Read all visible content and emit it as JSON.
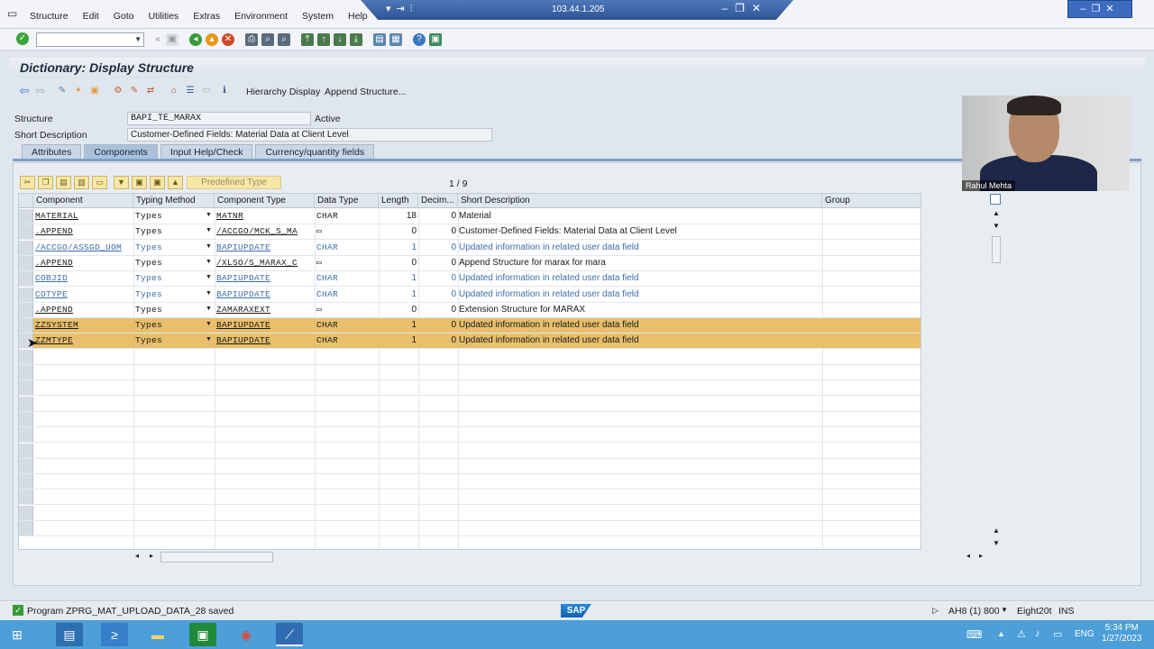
{
  "menubar": {
    "items": [
      "Structure",
      "Edit",
      "Goto",
      "Utilities",
      "Extras",
      "Environment",
      "System",
      "Help"
    ]
  },
  "remote": {
    "ip": "103.44.1.205"
  },
  "toolbar": {
    "command_value": ""
  },
  "title": "Dictionary: Display Structure",
  "app_toolbar": {
    "hierarchy": "Hierarchy Display",
    "append": "Append Structure..."
  },
  "header": {
    "structure_label": "Structure",
    "structure_value": "BAPI_TE_MARAX",
    "status": "Active",
    "short_desc_label": "Short Description",
    "short_desc_value": "Customer-Defined Fields: Material Data at Client Level"
  },
  "tabs": [
    "Attributes",
    "Components",
    "Input Help/Check",
    "Currency/quantity fields"
  ],
  "active_tab": "Components",
  "table_controls": {
    "predefined_type": "Predefined Type",
    "pager": "1 / 9"
  },
  "columns": [
    "Component",
    "Typing Method",
    "Component Type",
    "Data Type",
    "Length",
    "Decim...",
    "Short Description",
    "Group"
  ],
  "rows": [
    {
      "component": "MATERIAL",
      "typing": "Types",
      "comptype": "MATNR",
      "datatype": "CHAR",
      "length": "18",
      "decimals": "0",
      "desc": "Material"
    },
    {
      "component": ".APPEND",
      "typing": "Types",
      "comptype": "/ACCGO/MCK_S_MA",
      "datatype": "▭",
      "length": "0",
      "decimals": "0",
      "desc": "Customer-Defined Fields: Material Data at Client Level"
    },
    {
      "component": "/ACCGO/ASSGD_UOM",
      "typing": "Types",
      "comptype": "BAPIUPDATE",
      "datatype": "CHAR",
      "length": "1",
      "decimals": "0",
      "desc": "Updated information in related user data field"
    },
    {
      "component": ".APPEND",
      "typing": "Types",
      "comptype": "/XLSO/S_MARAX_C",
      "datatype": "▭",
      "length": "0",
      "decimals": "0",
      "desc": "Append Structure for marax for mara"
    },
    {
      "component": "COBJID",
      "typing": "Types",
      "comptype": "BAPIUPDATE",
      "datatype": "CHAR",
      "length": "1",
      "decimals": "0",
      "desc": "Updated information in related user data field"
    },
    {
      "component": "COTYPE",
      "typing": "Types",
      "comptype": "BAPIUPDATE",
      "datatype": "CHAR",
      "length": "1",
      "decimals": "0",
      "desc": "Updated information in related user data field"
    },
    {
      "component": ".APPEND",
      "typing": "Types",
      "comptype": "ZAMARAXEXT",
      "datatype": "▭",
      "length": "0",
      "decimals": "0",
      "desc": "Extension Structure for MARAX"
    },
    {
      "component": "ZZSYSTEM",
      "typing": "Types",
      "comptype": "BAPIUPDATE",
      "datatype": "CHAR",
      "length": "1",
      "decimals": "0",
      "desc": "Updated information in related user data field"
    },
    {
      "component": "ZZMTYPE",
      "typing": "Types",
      "comptype": "BAPIUPDATE",
      "datatype": "CHAR",
      "length": "1",
      "decimals": "0",
      "desc": "Updated information in related user data field"
    }
  ],
  "status": {
    "message": "Program ZPRG_MAT_UPLOAD_DATA_28 saved",
    "system": "AH8 (1) 800",
    "server": "Eight20t",
    "mode": "INS"
  },
  "taskbar": {
    "lang": "ENG",
    "time": "5:34 PM",
    "date": "1/27/2023"
  },
  "webcam": {
    "name": "Rahul Mehta"
  },
  "colors": {
    "selected_row": "#e8bf6a",
    "link_blue": "#3d6ea8",
    "title_bg": "#dde4ec"
  }
}
